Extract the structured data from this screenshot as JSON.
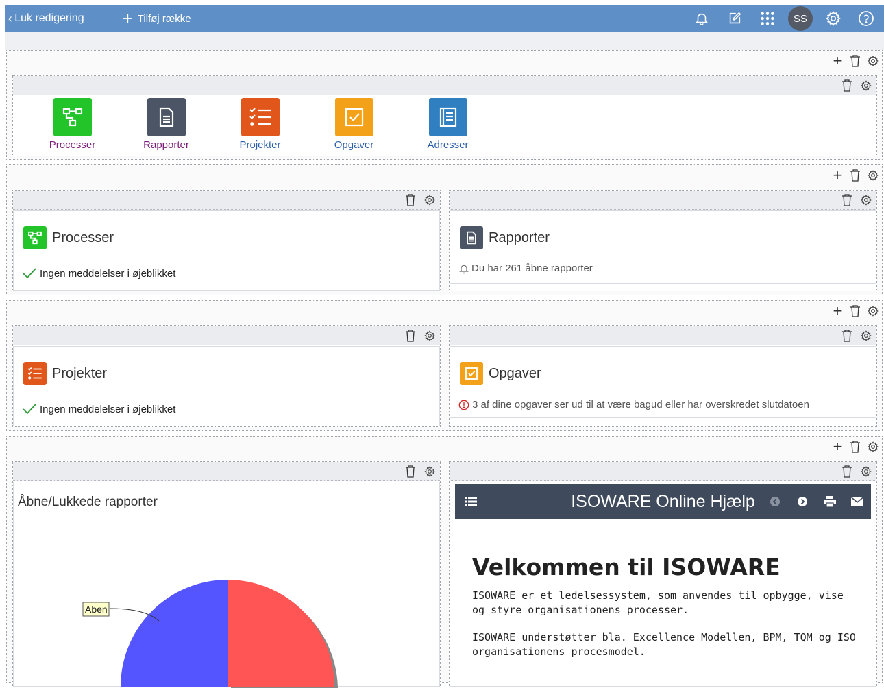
{
  "topbar": {
    "back_label": "Luk redigering",
    "add_row_label": "Tilføj række",
    "avatar_initials": "SS",
    "icons": [
      "bell-icon",
      "edit-icon",
      "apps-grid-icon",
      "settings-icon",
      "help-icon"
    ],
    "color": "#5e8fc6"
  },
  "quicklinks": [
    {
      "label": "Processer",
      "color": "#2ecc40",
      "label_color": "#7b1e7a",
      "icon": "process-icon"
    },
    {
      "label": "Rapporter",
      "color": "#4b5565",
      "label_color": "#7b1e7a",
      "icon": "document-icon"
    },
    {
      "label": "Projekter",
      "color": "#e0561b",
      "label_color": "#2c5fa8",
      "icon": "checklist-icon"
    },
    {
      "label": "Opgaver",
      "color": "#f4a11a",
      "label_color": "#2c5fa8",
      "icon": "checkbox-icon"
    },
    {
      "label": "Adresser",
      "color": "#2f7fc1",
      "label_color": "#2c5fa8",
      "icon": "address-book-icon"
    }
  ],
  "widgets": {
    "processer": {
      "title": "Processer",
      "message": "Ingen meddelelser i øjeblikket"
    },
    "rapporter": {
      "title": "Rapporter",
      "message": "Du har 261 åbne rapporter"
    },
    "projekter": {
      "title": "Projekter",
      "message": "Ingen meddelelser i øjeblikket"
    },
    "opgaver": {
      "title": "Opgaver",
      "message": "3 af dine opgaver ser ud til at være bagud eller har overskredet slutdatoen"
    }
  },
  "chart_widget": {
    "title": "Åbne/Lukkede rapporter",
    "annotation": "Aben"
  },
  "chart_data": {
    "type": "pie",
    "title": "Åbne/Lukkede rapporter",
    "slices": [
      {
        "label": "Aben",
        "color": "#5555ff"
      },
      {
        "label": "",
        "color": "#ff5555"
      }
    ]
  },
  "help": {
    "bar_title": "ISOWARE Online Hjælp",
    "heading": "Velkommen til ISOWARE",
    "para1": "ISOWARE er et ledelsessystem, som anvendes til opbygge, vise og styre organisationens processer.",
    "para2": "ISOWARE understøtter bla. Excellence Modellen, BPM,  TQM og ISO organisationens procesmodel."
  }
}
